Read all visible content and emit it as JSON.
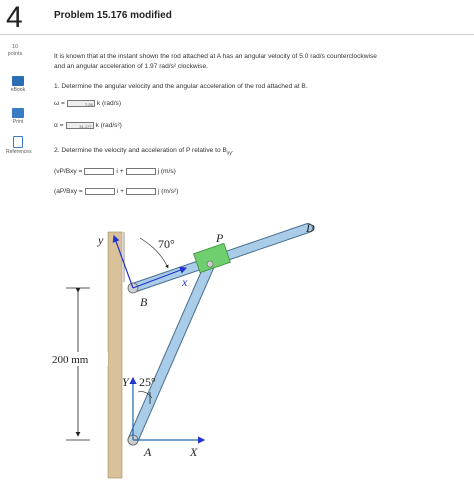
{
  "question": {
    "number": "4",
    "title": "Problem 15.176 modified",
    "points_value": "10",
    "points_label": "points"
  },
  "tools": [
    {
      "label": "eBook",
      "icon": "ebook-icon"
    },
    {
      "label": "Print",
      "icon": "print-icon"
    },
    {
      "label": "References",
      "icon": "references-icon"
    }
  ],
  "problem": {
    "statement_line1": "It is known that at the instant shown the rod attached at A has an angular velocity of 5.0 rad/s counterclockwise",
    "statement_line2": "and an angular acceleration of 1.97 rad/s² clockwise.",
    "part1": "1. Determine the angular velocity and the angular acceleration of the rod attached at B.",
    "omega_label": "ω =",
    "omega_value": "7.56",
    "omega_unit": "k (rad/s)",
    "alpha_label": "α =",
    "alpha_value": "31.177",
    "alpha_unit": "k (rad/s²)",
    "part2": "2. Determine the velocity and acceleration of P relative to B",
    "part2_sub": "xy",
    "part2_end": ".",
    "vel_label": "(vP/Bxy =",
    "vel_mid": "i +",
    "vel_unit": "j (m/s)",
    "acc_label": "(aP/Bxy =",
    "acc_mid": "i +",
    "acc_unit": "j (m/s²)"
  },
  "figure": {
    "angle_top": "70°",
    "angle_bottom": "25°",
    "dimension": "200 mm",
    "label_y": "y",
    "label_x": "x",
    "label_Y": "Y",
    "label_X": "X",
    "label_A": "A",
    "label_B": "B",
    "label_P": "P",
    "label_D": "D",
    "colors": {
      "wall": "#d9c29a",
      "rod": "#9fc6e4",
      "collar": "#6fcf6f",
      "axis": "#2233cc",
      "axis_frame": "#1a6ab0"
    }
  }
}
